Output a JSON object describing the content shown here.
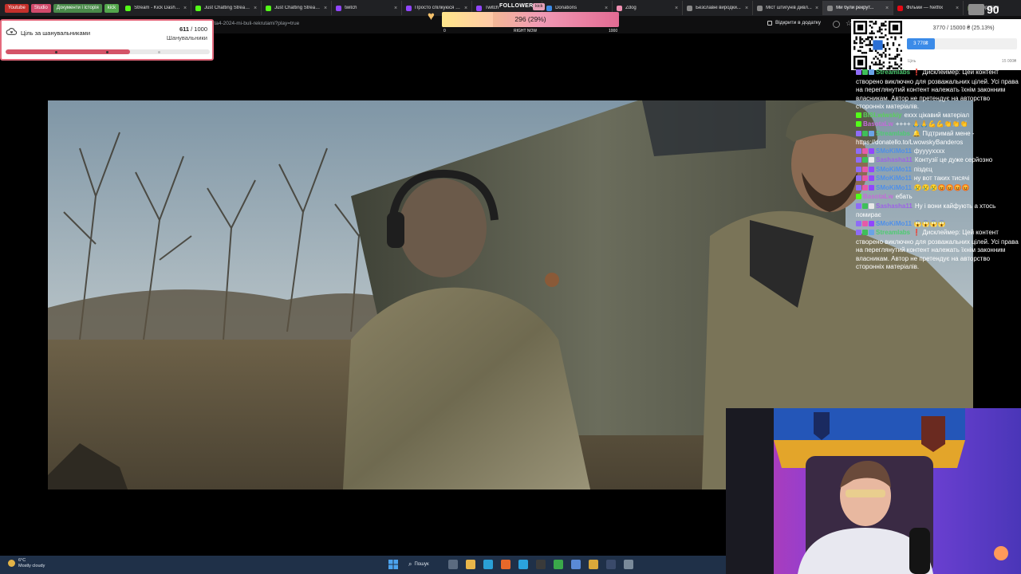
{
  "browser": {
    "bookmarks": [
      {
        "label": "Youtube",
        "color": "#c4302b"
      },
      {
        "label": "Studio",
        "color": "#d04a6b"
      },
      {
        "label": "Документи і історія",
        "color": "#4a8a4a"
      },
      {
        "label": "kick",
        "color": "#53a64c"
      }
    ],
    "tabs": [
      {
        "label": "Stream - Kick Dashb...",
        "color": "#53fc18",
        "active": false
      },
      {
        "label": "Just Chatting Stream...",
        "color": "#53fc18",
        "active": false
      },
      {
        "label": "Just Chatting Stream...",
        "color": "#53fc18",
        "active": false
      },
      {
        "label": "twitch",
        "color": "#9146ff",
        "active": false
      },
      {
        "label": "Просто спілкуюся в...",
        "color": "#9146ff",
        "active": false
      },
      {
        "label": "Twitch",
        "color": "#9146ff",
        "active": false
      },
      {
        "label": "Donations",
        "color": "#3b8be8",
        "active": false
      },
      {
        "label": "Zdog",
        "color": "#ef8fb1",
        "active": false
      },
      {
        "label": "Безславні виродки...",
        "color": "#888888",
        "active": false
      },
      {
        "label": "Міст штигунів дивл...",
        "color": "#888888",
        "active": false
      },
      {
        "label": "Ми були рекрут...",
        "color": "#888888",
        "active": true
      },
      {
        "label": "Фільми — Netflix",
        "color": "#e50914",
        "active": false
      },
      {
        "label": "DeepState",
        "color": "#5a6e4a",
        "active": false
      }
    ],
    "url": "lta4-2024-mi-buli-rekrutami?play=true",
    "open_in_app": "Відкрити в додатку",
    "close_glyph": "×"
  },
  "follower_goal": {
    "title": "Ціль за шанувальниками",
    "current": "611",
    "target": "/ 1000",
    "subtitle": "Шанувальники",
    "progress": 0.611
  },
  "followers_widget": {
    "title": "FOLLOWERS",
    "badge": "kick",
    "value_label": "296 (29%)",
    "progress": 0.29,
    "min_label": "0",
    "mid_label": "RIGHT NOW",
    "max_label": "1000"
  },
  "donation_goal": {
    "count_label": "3770 / 15000 ₴ (25.13%)",
    "fill_label": "3 770₴",
    "progress": 0.2513,
    "min_label": "Ціль",
    "max_label": "15 000₴"
  },
  "viewer_count": "90",
  "chat": {
    "messages": [
      {
        "user": "Streamlabs",
        "color": "#4ecb71",
        "badges": [
          "#8e6cf6",
          "#3fbf5a",
          "#6aa3e6"
        ],
        "text": "❗ Дисклеймер: Цей контент створено виключно для розважальних цілей. Усі права на переглянутий контент належать їхнім законним власникам. Автор не претендує на авторство сторонніх матеріалів."
      },
      {
        "user": "BISLwiwskiy",
        "color": "#5bd05b",
        "badges": [
          "#53fc18"
        ],
        "text": "еххх цікавий матеріал"
      },
      {
        "user": "BasotaLw",
        "color": "#c46bd9",
        "badges": [
          "#53fc18"
        ],
        "text": "++++ 🙏🙏💪💪👏👏👏"
      },
      {
        "user": "Streamlabs",
        "color": "#4ecb71",
        "badges": [
          "#8e6cf6",
          "#3fbf5a",
          "#6aa3e6"
        ],
        "text": "🔔 Підтримай мене - https://donatello.to/LwowskyBanderos"
      },
      {
        "user": "SMoKiMo11",
        "color": "#4f8fe8",
        "badges": [
          "#8e6cf6",
          "#e65aa8",
          "#9146ff"
        ],
        "text": "фууууxxxx"
      },
      {
        "user": "Sashasha11",
        "color": "#9d63e6",
        "badges": [
          "#8e6cf6",
          "#3fbf5a",
          "#e8e8e8"
        ],
        "text": "Контузії це дуже серйозно"
      },
      {
        "user": "SMoKiMo11",
        "color": "#4f8fe8",
        "badges": [
          "#8e6cf6",
          "#e65aa8",
          "#9146ff"
        ],
        "text": "піздєц"
      },
      {
        "user": "SMoKiMo11",
        "color": "#4f8fe8",
        "badges": [
          "#8e6cf6",
          "#e65aa8",
          "#9146ff"
        ],
        "text": "ну вот таких тисячі"
      },
      {
        "user": "SMoKiMo11",
        "color": "#4f8fe8",
        "badges": [
          "#8e6cf6",
          "#e65aa8",
          "#9146ff"
        ],
        "text": "😢😢😢😡😡😡😡"
      },
      {
        "user": "BasotaLw",
        "color": "#c46bd9",
        "badges": [
          "#53fc18"
        ],
        "text": "ебать"
      },
      {
        "user": "Sashasha11",
        "color": "#9d63e6",
        "badges": [
          "#8e6cf6",
          "#3fbf5a",
          "#e8e8e8"
        ],
        "text": "Ну і вони кайфують а хтось помирає"
      },
      {
        "user": "SMoKiMo11",
        "color": "#4f8fe8",
        "badges": [
          "#8e6cf6",
          "#e65aa8",
          "#9146ff"
        ],
        "text": "😱😱😱😱"
      },
      {
        "user": "Streamlabs",
        "color": "#4ecb71",
        "badges": [
          "#8e6cf6",
          "#3fbf5a",
          "#6aa3e6"
        ],
        "text": "❗ Дисклеймер: Цей контент створено виключно для розважальних цілей. Усі права на переглянутий контент належать їхнім законним власникам. Автор не претендує на авторство сторонніх матеріалів."
      }
    ]
  },
  "taskbar": {
    "weather_temp": "6°C",
    "weather_desc": "Mostly cloudy",
    "search_label": "Пошук",
    "apps": [
      {
        "icon": "task-view-icon",
        "color": "#5b6b80"
      },
      {
        "icon": "file-explorer-icon",
        "color": "#e8b64a"
      },
      {
        "icon": "edge-icon",
        "color": "#2aa0d6"
      },
      {
        "icon": "firefox-icon",
        "color": "#e8682a"
      },
      {
        "icon": "telegram-icon",
        "color": "#2ba3de"
      },
      {
        "icon": "obs-icon",
        "color": "#3a3a3a"
      },
      {
        "icon": "xbox-icon",
        "color": "#3aa84a"
      },
      {
        "icon": "store-icon",
        "color": "#5a8ad6"
      },
      {
        "icon": "chrome-icon",
        "color": "#d9a83a"
      },
      {
        "icon": "steam-icon",
        "color": "#3a4a6a"
      },
      {
        "icon": "settings-icon",
        "color": "#7a8a9a"
      }
    ]
  }
}
